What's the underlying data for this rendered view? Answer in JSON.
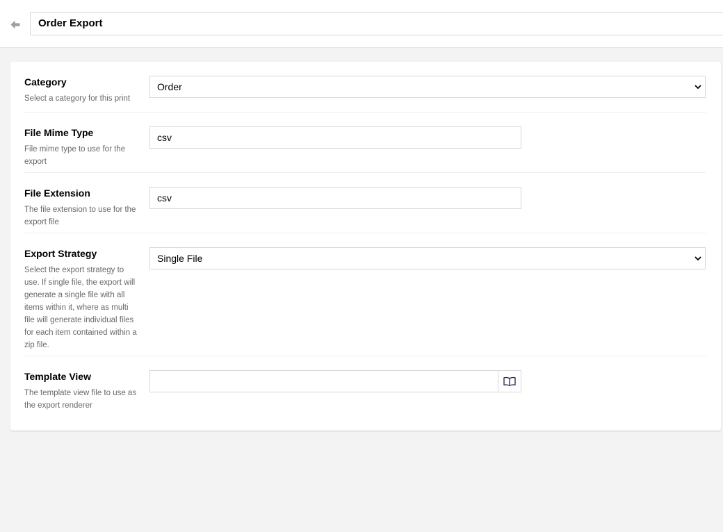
{
  "header": {
    "back_icon": "arrow-left-icon",
    "title": "Order Export"
  },
  "fields": {
    "category": {
      "label": "Category",
      "description": "Select a category for this print",
      "value": "Order"
    },
    "mime_type": {
      "label": "File Mime Type",
      "description": "File mime type to use for the export",
      "value": "csv"
    },
    "extension": {
      "label": "File Extension",
      "description": "The file extension to use for the export file",
      "value": "csv"
    },
    "strategy": {
      "label": "Export Strategy",
      "description": "Select the export strategy to use. If single file, the export will generate a single file with all items within it, where as multi file will generate individual files for each item contained within a zip file.",
      "value": "Single File"
    },
    "template_view": {
      "label": "Template View",
      "description": "The template view file to use as the export renderer",
      "value": "",
      "picker_icon": "book-icon"
    }
  },
  "colors": {
    "background": "#f3f3f3",
    "panel": "#ffffff",
    "border": "#d8d7d9",
    "muted_text": "#68676b"
  }
}
